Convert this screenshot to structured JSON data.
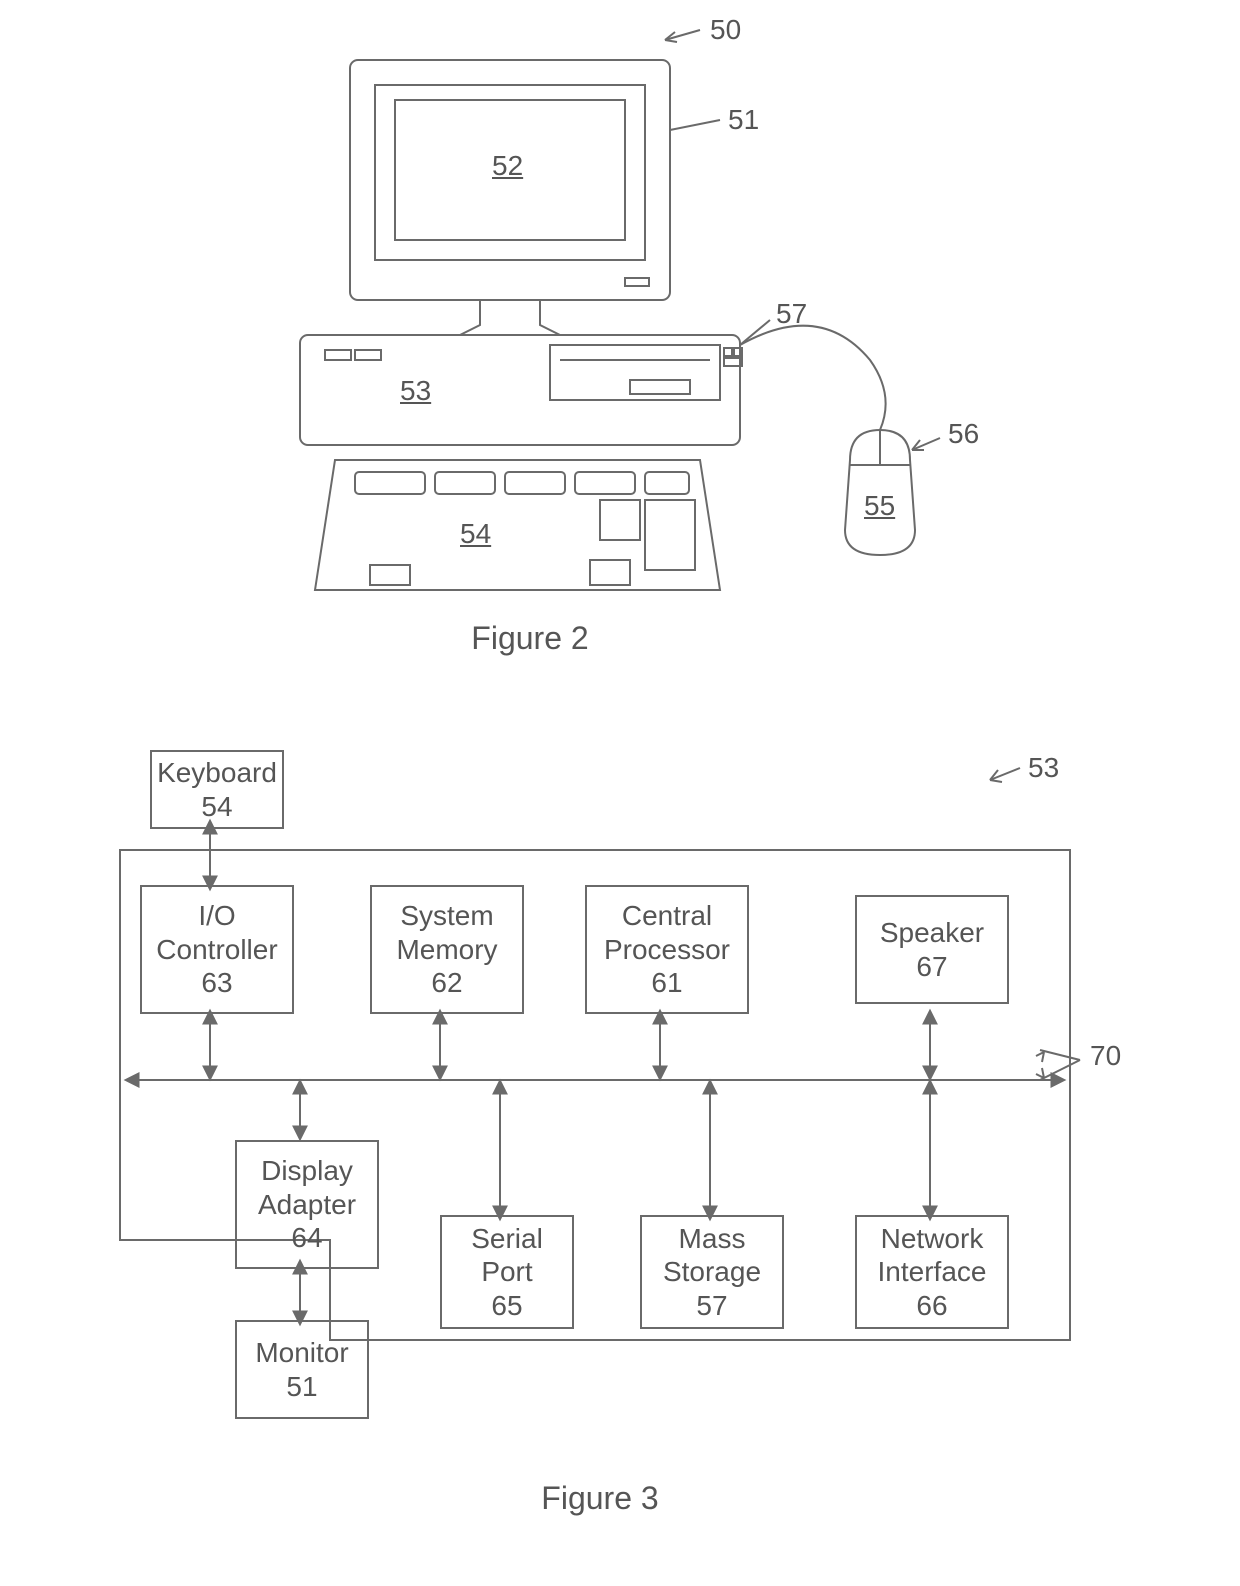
{
  "figure2": {
    "caption": "Figure 2",
    "labels": {
      "n50": "50",
      "n51": "51",
      "n52": "52",
      "n53": "53",
      "n54": "54",
      "n55": "55",
      "n56": "56",
      "n57": "57"
    }
  },
  "figure3": {
    "caption": "Figure 3",
    "labels": {
      "n53": "53",
      "n70": "70"
    },
    "boxes": {
      "keyboard": {
        "title": "Keyboard",
        "num": "54"
      },
      "io": {
        "title": "I/O Controller",
        "num": "63"
      },
      "sysmem": {
        "title": "System Memory",
        "num": "62"
      },
      "cpu": {
        "title": "Central Processor",
        "num": "61"
      },
      "speaker": {
        "title": "Speaker",
        "num": "67"
      },
      "display": {
        "title": "Display Adapter",
        "num": "64"
      },
      "serial": {
        "title": "Serial Port",
        "num": "65"
      },
      "mass": {
        "title": "Mass Storage",
        "num": "57"
      },
      "net": {
        "title": "Network Interface",
        "num": "66"
      },
      "monitor": {
        "title": "Monitor",
        "num": "51"
      }
    }
  }
}
